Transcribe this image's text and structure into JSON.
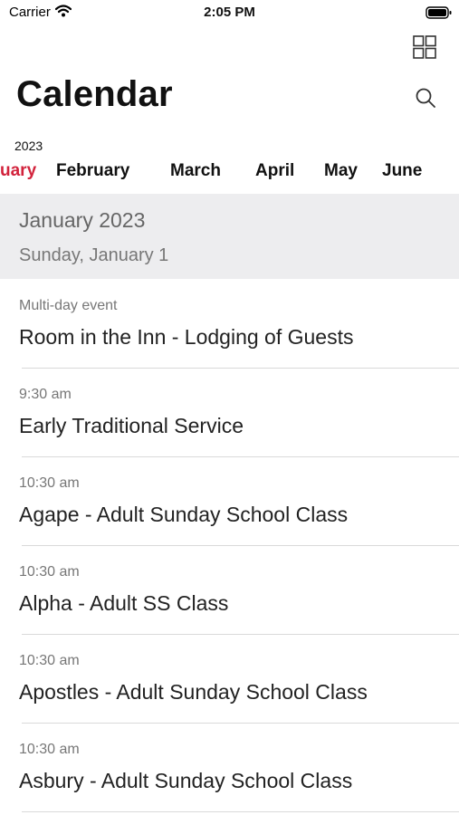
{
  "status_bar": {
    "carrier": "Carrier",
    "time": "2:05 PM"
  },
  "header": {
    "title": "Calendar"
  },
  "months": {
    "year": "2023",
    "items": [
      {
        "label": "uary",
        "active": true
      },
      {
        "label": "February",
        "active": false
      },
      {
        "label": "March",
        "active": false
      },
      {
        "label": "April",
        "active": false
      },
      {
        "label": "May",
        "active": false
      },
      {
        "label": "June",
        "active": false
      }
    ]
  },
  "section": {
    "month_title": "January 2023",
    "day_title": "Sunday, January 1"
  },
  "events": [
    {
      "time": "Multi-day event",
      "title": "Room in the Inn - Lodging of Guests"
    },
    {
      "time": "9:30 am",
      "title": "Early Traditional Service"
    },
    {
      "time": "10:30 am",
      "title": "Agape - Adult Sunday School Class"
    },
    {
      "time": "10:30 am",
      "title": "Alpha - Adult SS Class"
    },
    {
      "time": "10:30 am",
      "title": "Apostles - Adult Sunday School Class"
    },
    {
      "time": "10:30 am",
      "title": "Asbury - Adult Sunday School Class"
    }
  ],
  "colors": {
    "accent": "#d2233c",
    "section_bg": "#ededef",
    "divider": "#d9d9d9"
  }
}
